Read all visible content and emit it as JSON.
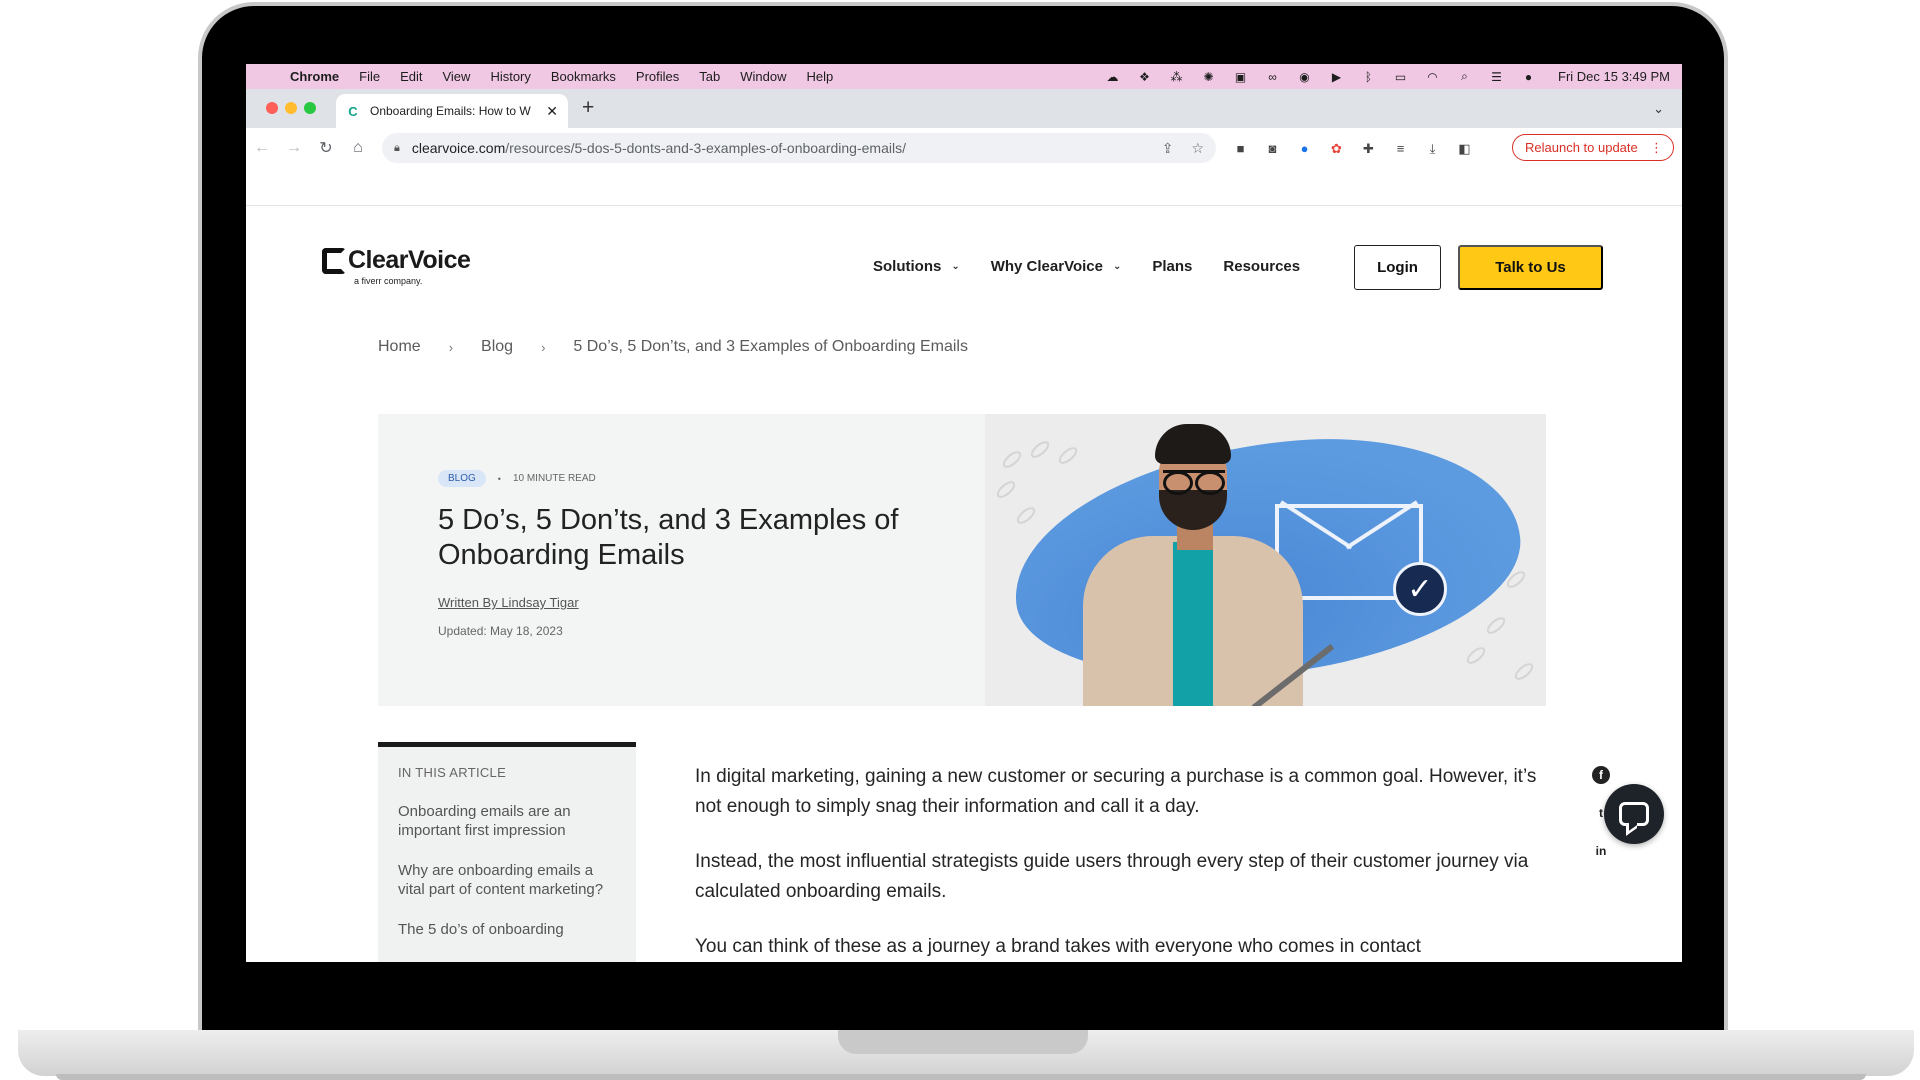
{
  "menubar": {
    "app": "Chrome",
    "items": [
      "File",
      "Edit",
      "View",
      "History",
      "Bookmarks",
      "Profiles",
      "Tab",
      "Window",
      "Help"
    ],
    "clock": "Fri Dec 15  3:49 PM",
    "status_icons": [
      "cloud-icon",
      "dropbox-icon",
      "craft-icon",
      "gear-icon",
      "screenshot-icon",
      "creative-cloud-icon",
      "chat-icon",
      "play-icon",
      "bluetooth-icon",
      "battery-icon",
      "wifi-icon",
      "search-icon",
      "control-center-icon",
      "siri-icon"
    ]
  },
  "browser": {
    "tab_title": "Onboarding Emails: How to W",
    "tab_close": "✕",
    "new_tab": "+",
    "tab_menu": "⌄",
    "url_host": "clearvoice.com",
    "url_path": "/resources/5-dos-5-donts-and-3-examples-of-onboarding-emails/",
    "relaunch_label": "Relaunch to update",
    "accent": "#d93025"
  },
  "site": {
    "logo_name": "ClearVoice",
    "logo_sub": "a fiverr company.",
    "nav": {
      "solutions": "Solutions",
      "why": "Why ClearVoice",
      "plans": "Plans",
      "resources": "Resources"
    },
    "login": "Login",
    "talk": "Talk to Us",
    "cta_color": "#ffc814"
  },
  "breadcrumb": {
    "home": "Home",
    "blog": "Blog",
    "current": "5 Do’s, 5 Don’ts, and 3 Examples of Onboarding Emails",
    "sep": "›"
  },
  "hero": {
    "badge": "BLOG",
    "read_time": "10 MINUTE READ",
    "title": "5 Do’s, 5 Don’ts, and 3 Examples of Onboarding Emails",
    "author": "Written By Lindsay Tigar",
    "updated": "Updated: May 18, 2023"
  },
  "toc": {
    "heading": "IN THIS ARTICLE",
    "items": [
      "Onboarding emails are an important first impression",
      "Why are onboarding emails a vital part of content marketing?",
      "The 5 do’s of onboarding"
    ]
  },
  "article": {
    "paragraphs": [
      "In digital marketing, gaining a new customer or securing a purchase is a common goal. However, it’s not enough to simply snag their information and call it a day.",
      "Instead, the most influential strategists guide users through every step of their customer journey via calculated onboarding emails.",
      "You can think of these as a journey a brand takes with everyone who comes in contact"
    ]
  },
  "social": [
    "facebook-icon",
    "twitter-icon",
    "linkedin-icon"
  ]
}
